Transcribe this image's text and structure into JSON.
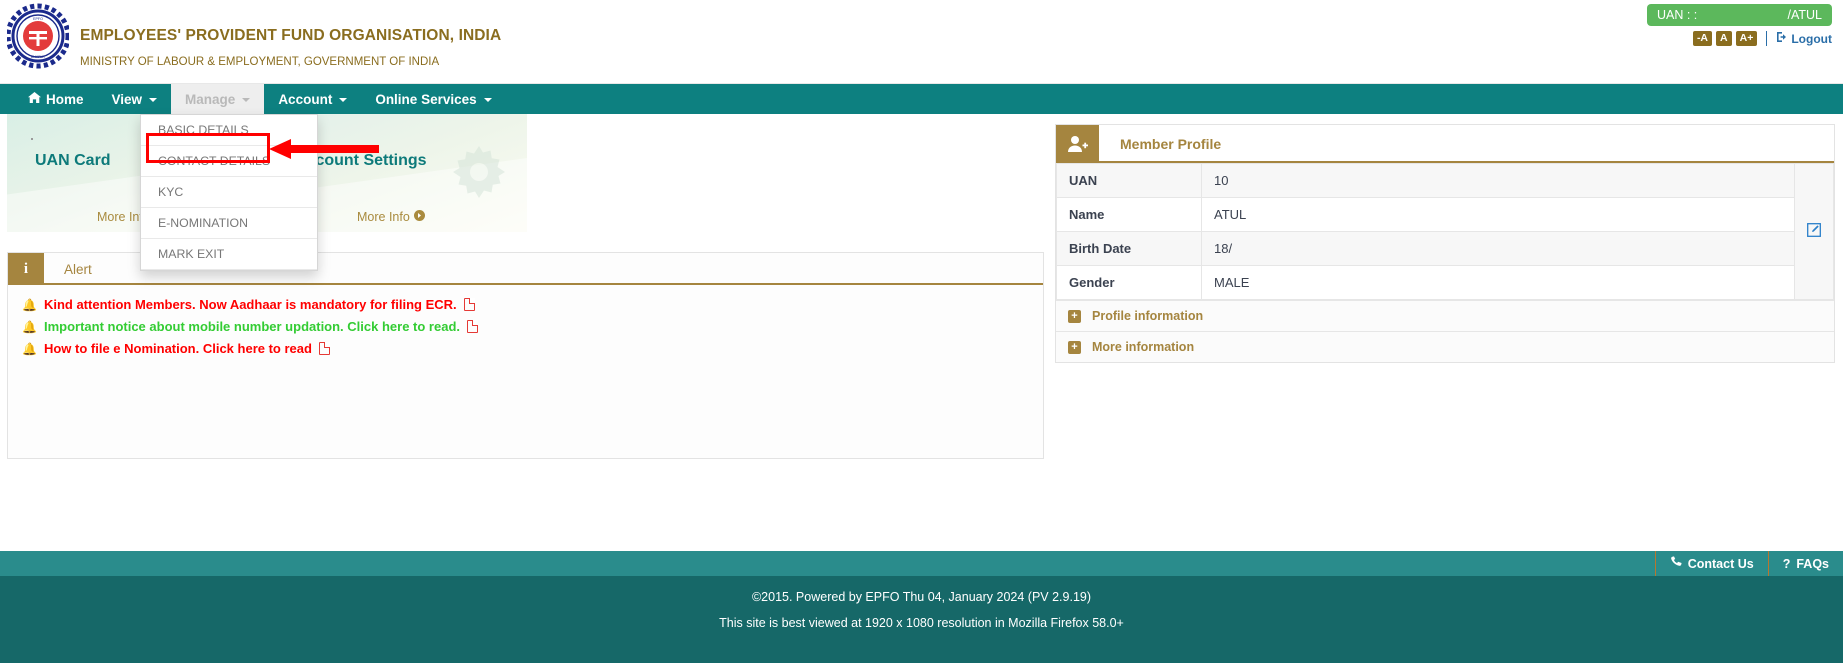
{
  "header": {
    "org_title": "EMPLOYEES' PROVIDENT FUND ORGANISATION, INDIA",
    "org_subtitle": "MINISTRY OF LABOUR & EMPLOYMENT, GOVERNMENT OF INDIA",
    "logo_icon": "epfo-emblem-icon",
    "uan_label": "UAN : :",
    "uan_value": "/ATUL",
    "font_decrease": "-A",
    "font_normal": "A",
    "font_increase": "A+",
    "logout_label": "Logout",
    "logout_icon": "logout-icon",
    "accent_gold": "#8a6d1f",
    "badge_green": "#5cb85c"
  },
  "nav": {
    "items": [
      {
        "label": "Home",
        "icon": "home-icon",
        "has_caret": false,
        "active": false
      },
      {
        "label": "View",
        "icon": "",
        "has_caret": true,
        "active": false
      },
      {
        "label": "Manage",
        "icon": "",
        "has_caret": true,
        "active": true
      },
      {
        "label": "Account",
        "icon": "",
        "has_caret": true,
        "active": false
      },
      {
        "label": "Online Services",
        "icon": "",
        "has_caret": true,
        "active": false
      }
    ],
    "bar_color": "#0d8080"
  },
  "dropdown": {
    "parent": "Manage",
    "items": [
      {
        "label": "BASIC DETAILS"
      },
      {
        "label": "CONTACT DETAILS"
      },
      {
        "label": "KYC"
      },
      {
        "label": "E-NOMINATION"
      },
      {
        "label": "MARK EXIT"
      }
    ],
    "highlight_index": 1,
    "highlight_color": "#ff0000",
    "annotation_icon": "red-arrow-pointer"
  },
  "cards": [
    {
      "title": "UAN Card",
      "more_info": "More Info",
      "icon": "card-icon"
    },
    {
      "title": "Account Settings",
      "more_info": "More Info",
      "icon": "gear-icon"
    }
  ],
  "alert": {
    "tab_icon": "info-icon",
    "tab_icon_glyph": "i",
    "title": "Alert",
    "items": [
      {
        "text": "Kind attention Members. Now Aadhaar is mandatory for filing ECR.",
        "color": "#ff0000",
        "bell_icon": "bell-icon",
        "pdf_icon": "pdf-icon"
      },
      {
        "text": "Important notice about mobile number updation. Click here to read.",
        "color": "#33cc33",
        "bell_icon": "bell-icon",
        "pdf_icon": "pdf-icon"
      },
      {
        "text": "How to file e Nomination. Click here to read",
        "color": "#ff0000",
        "bell_icon": "bell-icon",
        "pdf_icon": "pdf-icon"
      }
    ]
  },
  "profile": {
    "header_icon": "user-add-icon",
    "title": "Member Profile",
    "accent": "#a5853f",
    "rows": [
      {
        "key": "UAN",
        "value": "10"
      },
      {
        "key": "Name",
        "value": "ATUL"
      },
      {
        "key": "Birth Date",
        "value": "18/"
      },
      {
        "key": "Gender",
        "value": "MALE"
      }
    ],
    "edit_icon": "edit-pencil-icon",
    "collapsibles": [
      {
        "label": "Profile information",
        "icon": "plus-icon"
      },
      {
        "label": "More information",
        "icon": "plus-icon"
      }
    ]
  },
  "footer": {
    "contact_us": "Contact Us",
    "contact_icon": "phone-icon",
    "faqs": "FAQs",
    "faq_icon": "question-icon",
    "copyright": "©2015. Powered by EPFO Thu 04, January 2024 (PV 2.9.19)",
    "best_viewed": "This site is best viewed at 1920 x 1080 resolution in Mozilla Firefox 58.0+",
    "bar_color": "#2a8c8c",
    "main_color": "#166868"
  }
}
